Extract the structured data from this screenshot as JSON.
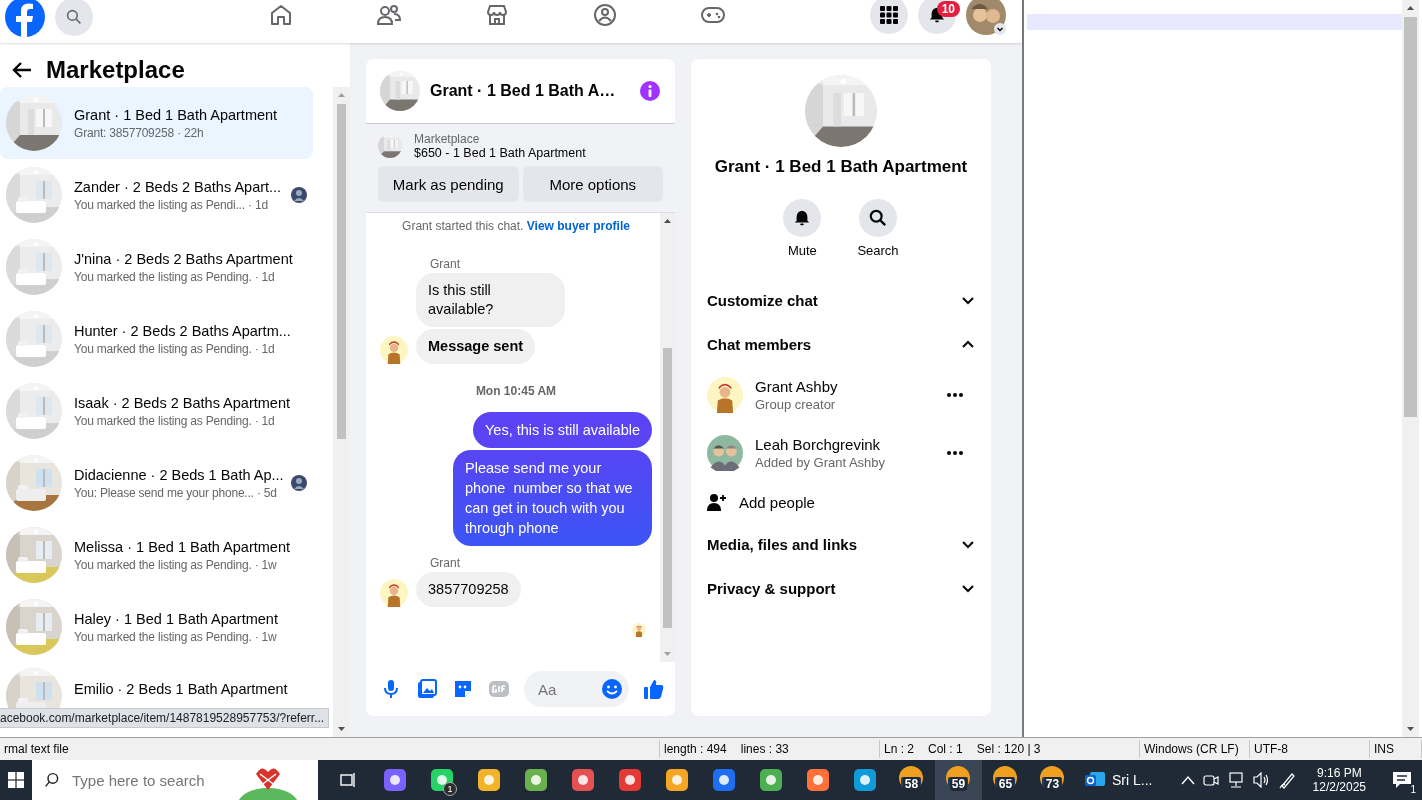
{
  "top_bar": {
    "notification_count": "10"
  },
  "sidebar": {
    "title": "Marketplace",
    "conversations": [
      {
        "title": "Grant · 1 Bed 1 Bath Apartment",
        "snippet": "Grant: 3857709258 · 22h",
        "selected": true,
        "seen_avatar": false
      },
      {
        "title": "Zander · 2 Beds 2 Baths Apart...",
        "snippet": "You marked the listing as Pendi... · 1d",
        "selected": false,
        "seen_avatar": true
      },
      {
        "title": "J'nina · 2 Beds 2 Baths Apartment",
        "snippet": "You marked the listing as Pending. · 1d",
        "selected": false,
        "seen_avatar": false
      },
      {
        "title": "Hunter · 2 Beds 2 Baths Apartm...",
        "snippet": "You marked the listing as Pending. · 1d",
        "selected": false,
        "seen_avatar": false
      },
      {
        "title": "Isaak · 2 Beds 2 Baths Apartment",
        "snippet": "You marked the listing as Pending. · 1d",
        "selected": false,
        "seen_avatar": false
      },
      {
        "title": "Didacienne · 2 Beds 1 Bath Ap...",
        "snippet": "You: Please send me your phone... · 5d",
        "selected": false,
        "seen_avatar": true
      },
      {
        "title": "Melissa · 1 Bed 1 Bath Apartment",
        "snippet": "You marked the listing as Pending. · 1w",
        "selected": false,
        "seen_avatar": false
      },
      {
        "title": "Haley · 1 Bed 1 Bath Apartment",
        "snippet": "You marked the listing as Pending. · 1w",
        "selected": false,
        "seen_avatar": false
      },
      {
        "title": "Emilio · 2 Beds 1 Bath Apartment",
        "selected": false,
        "seen_avatar": false
      }
    ]
  },
  "link_preview": "acebook.com/marketplace/item/1487819528957753/?referr...",
  "chat": {
    "title": "Grant · 1 Bed 1 Bath A…",
    "listing": {
      "source": "Marketplace",
      "title": "$650 - 1 Bed 1 Bath Apartment",
      "actions": [
        "Mark as pending",
        "More options"
      ]
    },
    "messages": [
      {
        "kind": "system",
        "text": "Grant started this chat.",
        "link": "View buyer profile"
      },
      {
        "kind": "sender",
        "text": "Grant"
      },
      {
        "kind": "incoming",
        "text": "Is this still available?",
        "emphasis": false,
        "avatar": false
      },
      {
        "kind": "incoming",
        "text": "Message sent",
        "emphasis": true,
        "avatar": true
      },
      {
        "kind": "timestamp",
        "text": "Mon 10:45 AM"
      },
      {
        "kind": "outgoing",
        "text": "Yes, this is still available"
      },
      {
        "kind": "outgoing",
        "text": "Please send me your phone  number so that we can get in touch with you through phone"
      },
      {
        "kind": "sender",
        "text": "Grant"
      },
      {
        "kind": "incoming",
        "text": "3857709258",
        "emphasis": false,
        "avatar": true
      },
      {
        "kind": "seen"
      }
    ],
    "composer": {
      "placeholder": "Aa"
    }
  },
  "info": {
    "title": "Grant · 1 Bed 1 Bath Apartment",
    "actions": [
      {
        "kind": "mute",
        "label": "Mute"
      },
      {
        "kind": "search",
        "label": "Search"
      }
    ],
    "sections": [
      {
        "label": "Customize chat",
        "expanded": false
      },
      {
        "label": "Chat members",
        "expanded": true,
        "members": [
          {
            "name": "Grant Ashby",
            "role": "Group creator",
            "kind": "single"
          },
          {
            "name": "Leah Borchgrevink",
            "role": "Added by Grant Ashby",
            "kind": "pair"
          }
        ],
        "add_label": "Add people"
      },
      {
        "label": "Media, files and links",
        "expanded": false
      },
      {
        "label": "Privacy & support",
        "expanded": false
      }
    ]
  },
  "status_bar": {
    "file_type": "rmal text file",
    "length": "length : 494",
    "lines": "lines : 33",
    "ln": "Ln : 2",
    "col": "Col : 1",
    "sel": "Sel : 120 | 3",
    "eol": "Windows (CR LF)",
    "encoding": "UTF-8",
    "mode": "INS"
  },
  "taskbar": {
    "search_placeholder": "Type here to search",
    "apps": [
      {
        "active": false
      },
      {
        "active": false,
        "badge": "1"
      },
      {
        "active": false
      },
      {
        "active": false
      },
      {
        "active": false
      },
      {
        "active": false
      },
      {
        "active": false
      },
      {
        "active": false
      },
      {
        "active": false
      },
      {
        "active": false
      },
      {
        "active": false
      },
      {
        "active": false,
        "label": "58"
      },
      {
        "active": true,
        "label": "59"
      },
      {
        "active": false,
        "label": "65"
      },
      {
        "active": false,
        "label": "73"
      },
      {
        "active": false,
        "text": "Sri L..."
      }
    ],
    "time": "9:16 PM",
    "date": "12/2/2025",
    "notifications": "1"
  }
}
